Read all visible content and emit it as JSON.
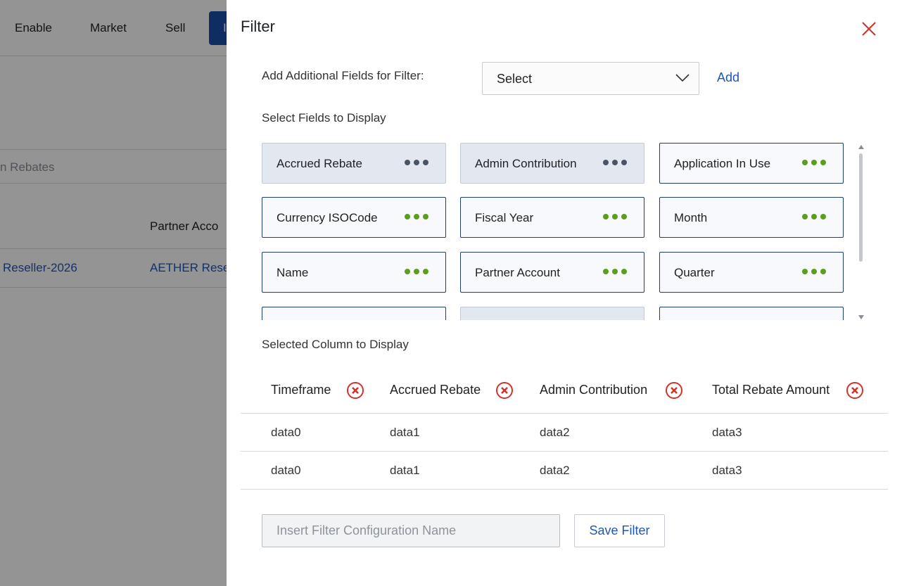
{
  "background": {
    "nav_items": [
      "Enable",
      "Market",
      "Sell",
      "I"
    ],
    "search_partial": "n Rebates",
    "column_header_partial": "Partner Acco",
    "row_link_1": "Reseller-2026",
    "row_link_2": "AETHER Rese"
  },
  "panel": {
    "title": "Filter",
    "close_icon": "close-icon",
    "add_fields": {
      "label": "Add Additional Fields for Filter:",
      "select_value": "Select",
      "add_label": "Add"
    },
    "fields_label": "Select Fields to Display",
    "fields": [
      {
        "label": "Accrued Rebate",
        "state": "selected"
      },
      {
        "label": "Admin Contribution",
        "state": "selected"
      },
      {
        "label": "Application In Use",
        "state": "available"
      },
      {
        "label": "Currency ISOCode",
        "state": "available"
      },
      {
        "label": "Fiscal Year",
        "state": "available"
      },
      {
        "label": "Month",
        "state": "available"
      },
      {
        "label": "Name",
        "state": "available"
      },
      {
        "label": "Partner Account",
        "state": "available"
      },
      {
        "label": "Quarter",
        "state": "available"
      },
      {
        "label": "",
        "state": "available"
      },
      {
        "label": "",
        "state": "selected"
      },
      {
        "label": "",
        "state": "available"
      }
    ],
    "selected_label": "Selected Column to Display",
    "columns": [
      "Timeframe",
      "Accrued Rebate",
      "Admin Contribution",
      "Total Rebate Amount"
    ],
    "rows": [
      [
        "data0",
        "data1",
        "data2",
        "data3"
      ],
      [
        "data0",
        "data1",
        "data2",
        "data3"
      ]
    ],
    "config_placeholder": "Insert Filter Configuration Name",
    "save_label": "Save Filter"
  },
  "colors": {
    "accent": "#1f57b5",
    "dots_active": "#5a9e1a",
    "dots_disabled": "#4a5463",
    "remove_icon": "#d0332b",
    "close_icon": "#d0332b"
  }
}
